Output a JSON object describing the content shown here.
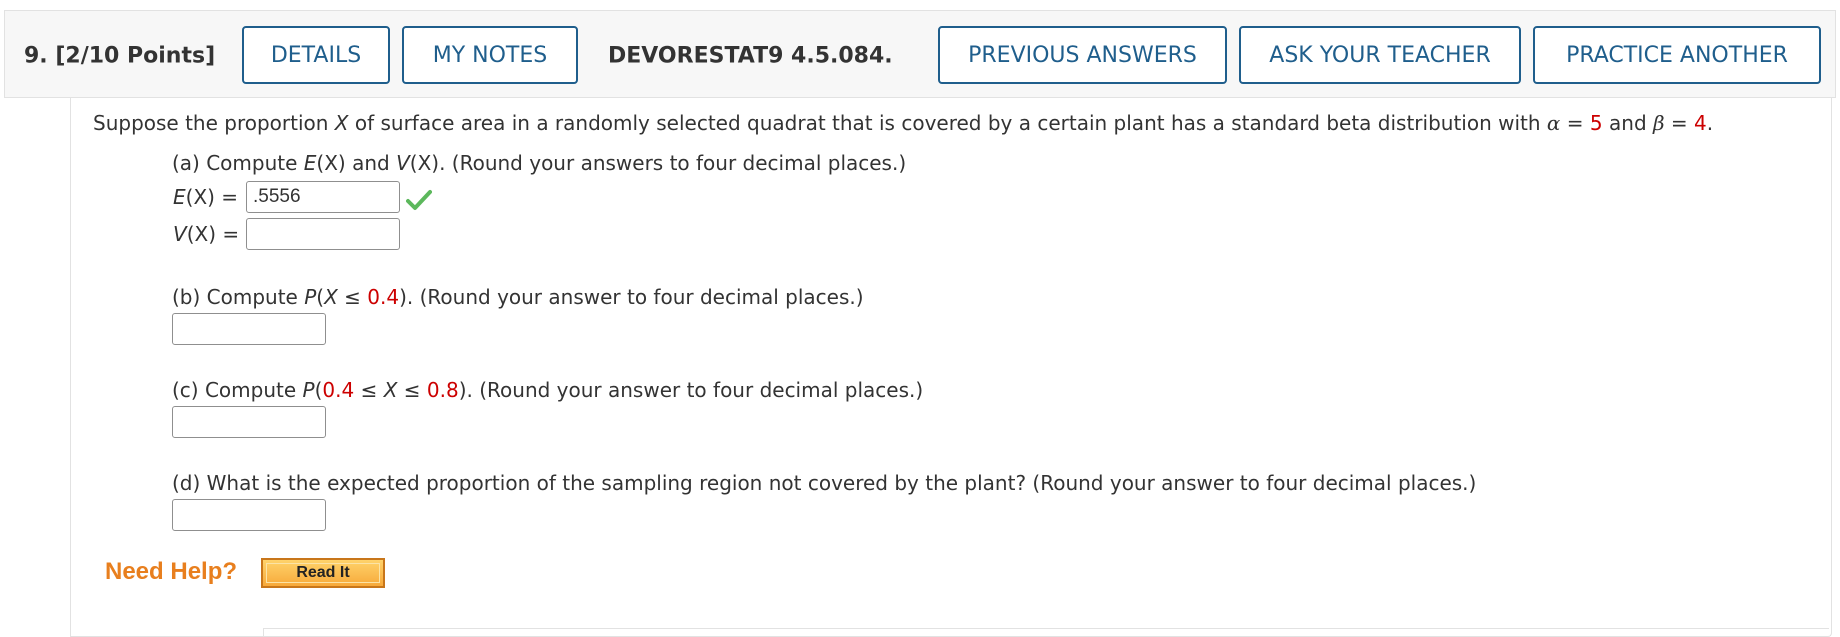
{
  "header": {
    "question_number": "9.",
    "points": "[2/10 Points]",
    "details_label": "DETAILS",
    "my_notes_label": "MY NOTES",
    "reference": "DEVORESTAT9 4.5.084.",
    "previous_answers_label": "PREVIOUS ANSWERS",
    "ask_teacher_label": "ASK YOUR TEACHER",
    "practice_another_label": "PRACTICE ANOTHER",
    "button_color": "#1f5e8c"
  },
  "question": {
    "intro_pre": "Suppose the proportion ",
    "intro_var": "X",
    "intro_mid": " of surface area in a randomly selected quadrat that is covered by a certain plant has a standard beta distribution with ",
    "alpha_symbol": "α",
    "equals": " = ",
    "alpha_value": "5",
    "and_text": " and ",
    "beta_symbol": "β",
    "beta_value": "4",
    "period": ".",
    "highlight_color": "#cc0000"
  },
  "part_a": {
    "prefix": "(a) Compute ",
    "e_func": "E",
    "e_arg": "(X)",
    "and_text": " and ",
    "v_func": "V",
    "v_arg": "(X)",
    "suffix": ". (Round your answers to four decimal places.)",
    "ex_label_func": "E",
    "ex_label_arg": "(X) =",
    "ex_value": ".5556",
    "ex_status": "correct",
    "vx_label_func": "V",
    "vx_label_arg": "(X) =",
    "vx_value": ""
  },
  "part_b": {
    "prefix": "(b) Compute ",
    "p_func": "P",
    "open": "(",
    "var": "X",
    "leq": " ≤ ",
    "value": "0.4",
    "close": ")",
    "suffix": ". (Round your answer to four decimal places.)",
    "answer": ""
  },
  "part_c": {
    "prefix": "(c) Compute ",
    "p_func": "P",
    "open": "(",
    "low": "0.4",
    "leq1": " ≤ ",
    "var": "X",
    "leq2": " ≤ ",
    "high": "0.8",
    "close": ")",
    "suffix": ". (Round your answer to four decimal places.)",
    "answer": ""
  },
  "part_d": {
    "text": "(d) What is the expected proportion of the sampling region not covered by the plant? (Round your answer to four decimal places.)",
    "answer": ""
  },
  "help": {
    "need_help": "Need Help?",
    "read_it": "Read It",
    "need_help_color": "#e87f1e"
  }
}
